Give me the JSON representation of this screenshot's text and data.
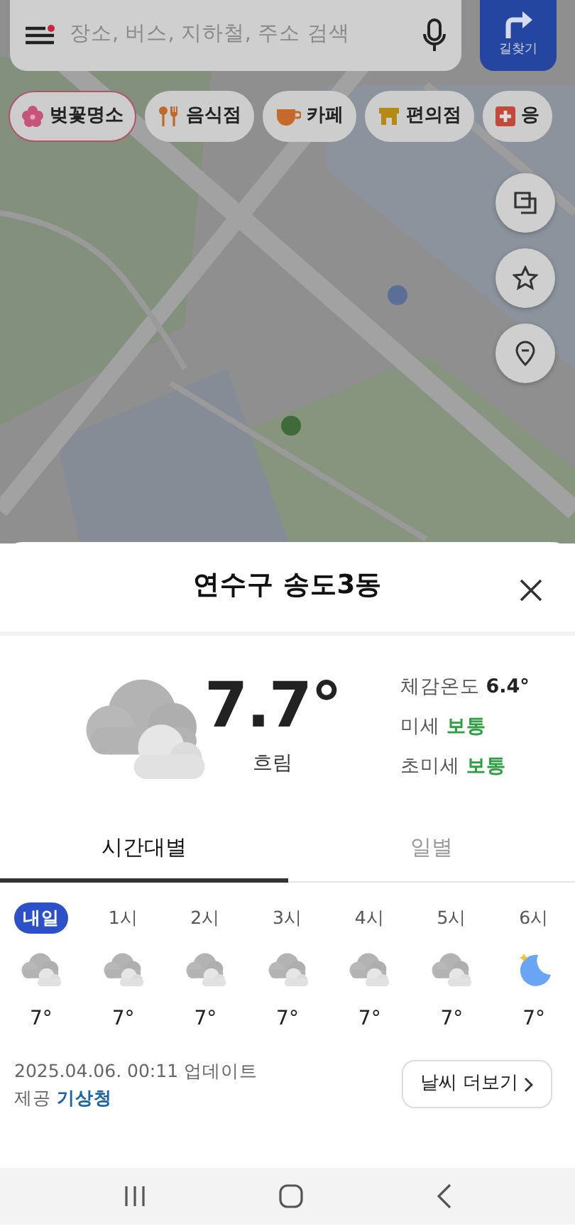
{
  "search": {
    "placeholder": "장소, 버스, 지하철, 주소 검색",
    "has_notification": true
  },
  "route_button": {
    "label": "길찾기"
  },
  "chips": [
    {
      "label": "벚꽃명소",
      "kind": "blossom",
      "selected": true
    },
    {
      "label": "음식점",
      "kind": "food",
      "selected": false
    },
    {
      "label": "카페",
      "kind": "cafe",
      "selected": false
    },
    {
      "label": "편의점",
      "kind": "store",
      "selected": false
    },
    {
      "label": "응",
      "kind": "hospital",
      "selected": false
    }
  ],
  "map_buttons": [
    {
      "kind": "layers"
    },
    {
      "kind": "favorite"
    },
    {
      "kind": "pin"
    }
  ],
  "weather": {
    "location": "연수구 송도3동",
    "temperature": "7.7°",
    "condition": "흐림",
    "details": [
      {
        "label": "체감온도",
        "value": "6.4°",
        "color": "#222222"
      },
      {
        "label": "미세",
        "value": "보통",
        "color": "#2f9e44"
      },
      {
        "label": "초미세",
        "value": "보통",
        "color": "#2f9e44"
      }
    ]
  },
  "tabs": [
    {
      "label": "시간대별",
      "selected": true
    },
    {
      "label": "일별",
      "selected": false
    }
  ],
  "hourly": [
    {
      "time": "내일",
      "highlighted": true,
      "kind": "cloudy",
      "temp": "7°"
    },
    {
      "time": "1시",
      "highlighted": false,
      "kind": "cloudy",
      "temp": "7°"
    },
    {
      "time": "2시",
      "highlighted": false,
      "kind": "cloudy",
      "temp": "7°"
    },
    {
      "time": "3시",
      "highlighted": false,
      "kind": "cloudy",
      "temp": "7°"
    },
    {
      "time": "4시",
      "highlighted": false,
      "kind": "cloudy",
      "temp": "7°"
    },
    {
      "time": "5시",
      "highlighted": false,
      "kind": "cloudy",
      "temp": "7°"
    },
    {
      "time": "6시",
      "highlighted": false,
      "kind": "night",
      "temp": "7°"
    }
  ],
  "footer": {
    "updated": "2025.04.06. 00:11 업데이트",
    "source_label": "제공",
    "source": "기상청",
    "more_button": "날씨 더보기"
  }
}
